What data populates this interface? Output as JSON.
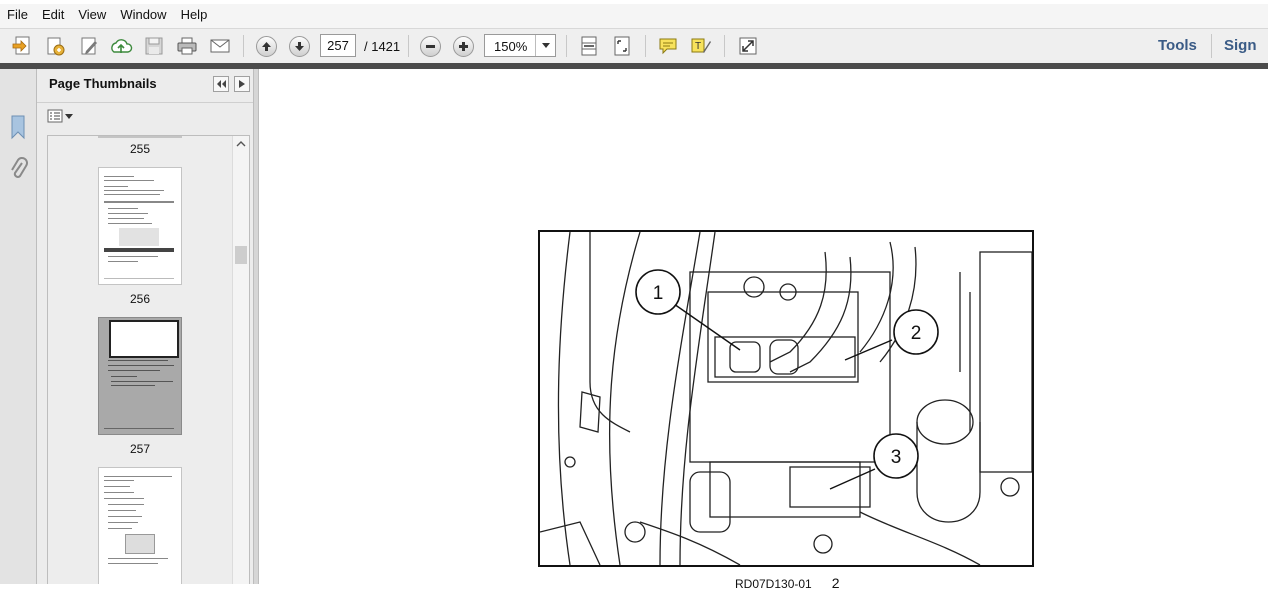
{
  "menu": [
    "File",
    "Edit",
    "View",
    "Window",
    "Help"
  ],
  "toolbar": {
    "page_current": "257",
    "page_total": "/ 1421",
    "zoom": "150%",
    "tools": "Tools",
    "sign": "Sign"
  },
  "panel": {
    "title": "Page Thumbnails",
    "pages": [
      "255",
      "256",
      "257"
    ],
    "selected_page": "257"
  },
  "figure": {
    "callouts": [
      "1",
      "2",
      "3"
    ],
    "code": "RD07D130-01",
    "number": "2"
  }
}
